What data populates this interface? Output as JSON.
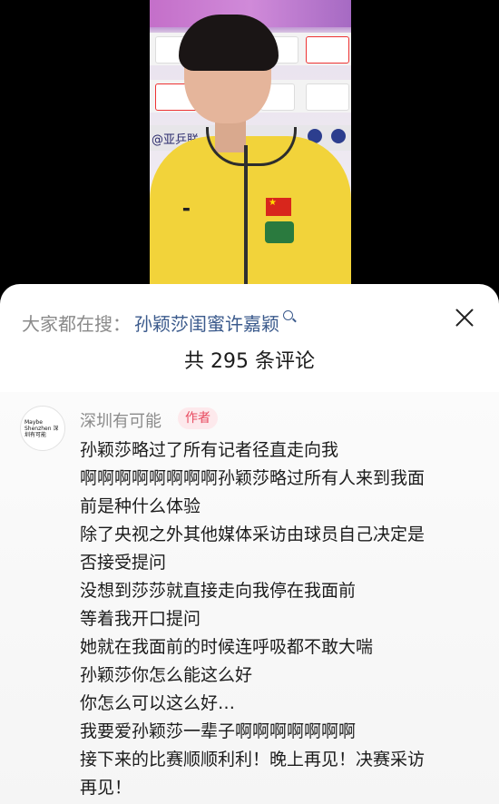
{
  "video": {
    "board_handle": "@亚乒联"
  },
  "panel": {
    "search_prefix": "大家都在搜：",
    "search_term": "孙颖莎闺蜜许嘉颖",
    "comment_count": "共 295 条评论"
  },
  "comment": {
    "avatar_text": "Maybe Shenzhen 深圳有可能",
    "author": "深圳有可能",
    "badge": "作者",
    "lines": [
      "孙颖莎略过了所有记者径直走向我",
      "啊啊啊啊啊啊啊啊孙颖莎略过所有人来到我面",
      "前是种什么体验",
      "除了央视之外其他媒体采访由球员自己决定是",
      "否接受提问",
      "没想到莎莎就直接走向我停在我面前",
      "等着我开口提问",
      "她就在我面前的时候连呼吸都不敢大喘",
      "孙颖莎你怎么能这么好",
      "你怎么可以这么好…",
      "我要爱孙颖莎一辈子啊啊啊啊啊啊啊",
      "接下来的比赛顺顺利利！晚上再见！决赛采访",
      "再见！"
    ]
  },
  "colors": {
    "accent_link": "#3b5a8c",
    "badge": "#e84a5f",
    "jersey": "#f2d33a"
  }
}
